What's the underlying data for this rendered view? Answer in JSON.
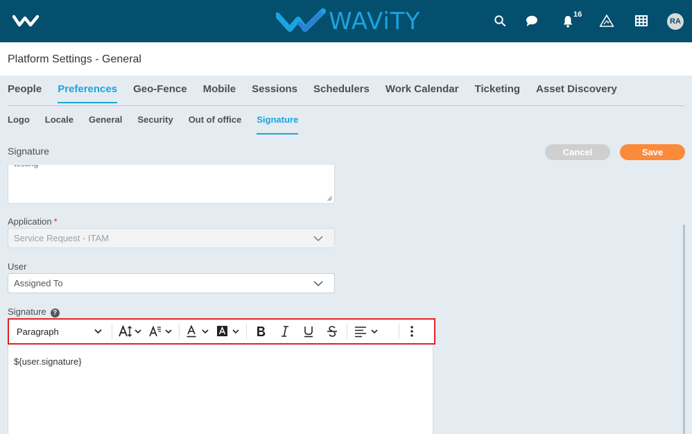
{
  "header": {
    "brand_name": "WAViTY",
    "notification_count": "16",
    "user_initials": "RA",
    "icons": [
      "search-icon",
      "chat-icon",
      "bell-icon",
      "alert-triangle-icon",
      "grid-icon"
    ]
  },
  "page": {
    "title": "Platform Settings - General"
  },
  "tabs": [
    {
      "label": "People"
    },
    {
      "label": "Preferences"
    },
    {
      "label": "Geo-Fence"
    },
    {
      "label": "Mobile"
    },
    {
      "label": "Sessions"
    },
    {
      "label": "Schedulers"
    },
    {
      "label": "Work Calendar"
    },
    {
      "label": "Ticketing"
    },
    {
      "label": "Asset Discovery"
    }
  ],
  "active_tab": "Preferences",
  "subtabs": [
    {
      "label": "Logo"
    },
    {
      "label": "Locale"
    },
    {
      "label": "General"
    },
    {
      "label": "Security"
    },
    {
      "label": "Out of office"
    },
    {
      "label": "Signature"
    }
  ],
  "active_subtab": "Signature",
  "section": {
    "title": "Signature",
    "cancel_label": "Cancel",
    "save_label": "Save"
  },
  "form": {
    "top_textarea_value": "testing",
    "application_label": "Application",
    "application_required": "*",
    "application_value": "Service Request - ITAM",
    "user_label": "User",
    "user_value": "Assigned To",
    "signature_label": "Signature",
    "help_glyph": "?"
  },
  "editor": {
    "block_format": "Paragraph",
    "content": "${user.signature}",
    "toolbar_icons": [
      "font-size-icon",
      "line-height-icon",
      "text-color-icon",
      "highlight-color-icon",
      "bold-icon",
      "italic-icon",
      "underline-icon",
      "strikethrough-icon",
      "align-icon",
      "more-icon"
    ]
  },
  "colors": {
    "header_bg": "#044e6e",
    "accent": "#1ba4e0",
    "save": "#fb8a3b",
    "cancel": "#cfcfcf",
    "highlight_border": "#e02020",
    "page_bg": "#e4ecf1"
  }
}
